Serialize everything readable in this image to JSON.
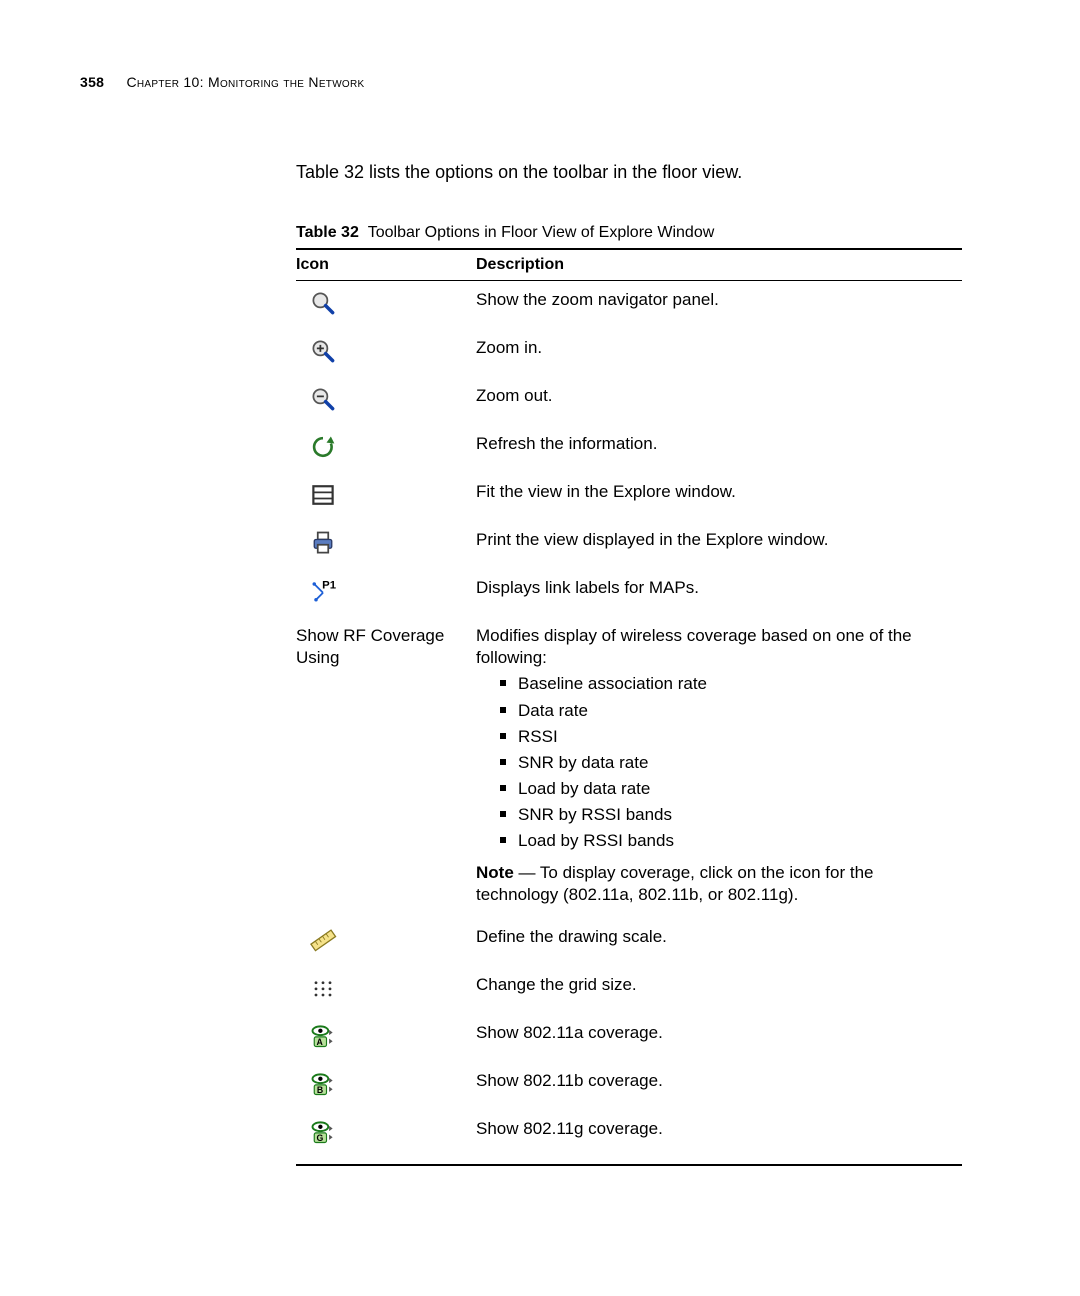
{
  "page_number": "358",
  "running_head_prefix": "Chapter 10: ",
  "running_head_title": "Monitoring the Network",
  "intro_text": "Table 32 lists the options on the toolbar in the floor view.",
  "table_caption_label": "Table 32",
  "table_caption_title": "Toolbar Options in Floor View of Explore Window",
  "columns": {
    "icon": "Icon",
    "desc": "Description"
  },
  "rows": {
    "r1": {
      "desc": "Show the zoom navigator panel."
    },
    "r2": {
      "desc": "Zoom in."
    },
    "r3": {
      "desc": "Zoom out."
    },
    "r4": {
      "desc": "Refresh the information."
    },
    "r5": {
      "desc": "Fit the view in the Explore window."
    },
    "r6": {
      "desc": "Print the view displayed in the Explore window."
    },
    "r7": {
      "desc": "Displays link labels for MAPs."
    },
    "r8": {
      "icon_text_line1": "Show RF Coverage",
      "icon_text_line2": "Using",
      "desc_lead": "Modifies display of wireless coverage based on one of the following:",
      "bullets": {
        "b1": "Baseline association rate",
        "b2": "Data rate",
        "b3": "RSSI",
        "b4": "SNR by data rate",
        "b5": "Load by data rate",
        "b6": "SNR by RSSI bands",
        "b7": "Load by RSSI bands"
      },
      "note_label": "Note",
      "note_text": " — To display coverage, click on the icon for the technology (802.11a, 802.11b, or 802.11g)."
    },
    "r9": {
      "desc": "Define the drawing scale."
    },
    "r10": {
      "desc": "Change the grid size."
    },
    "r11": {
      "desc": "Show 802.11a coverage."
    },
    "r12": {
      "desc": "Show 802.11b coverage."
    },
    "r13": {
      "desc": "Show 802.11g coverage."
    }
  }
}
